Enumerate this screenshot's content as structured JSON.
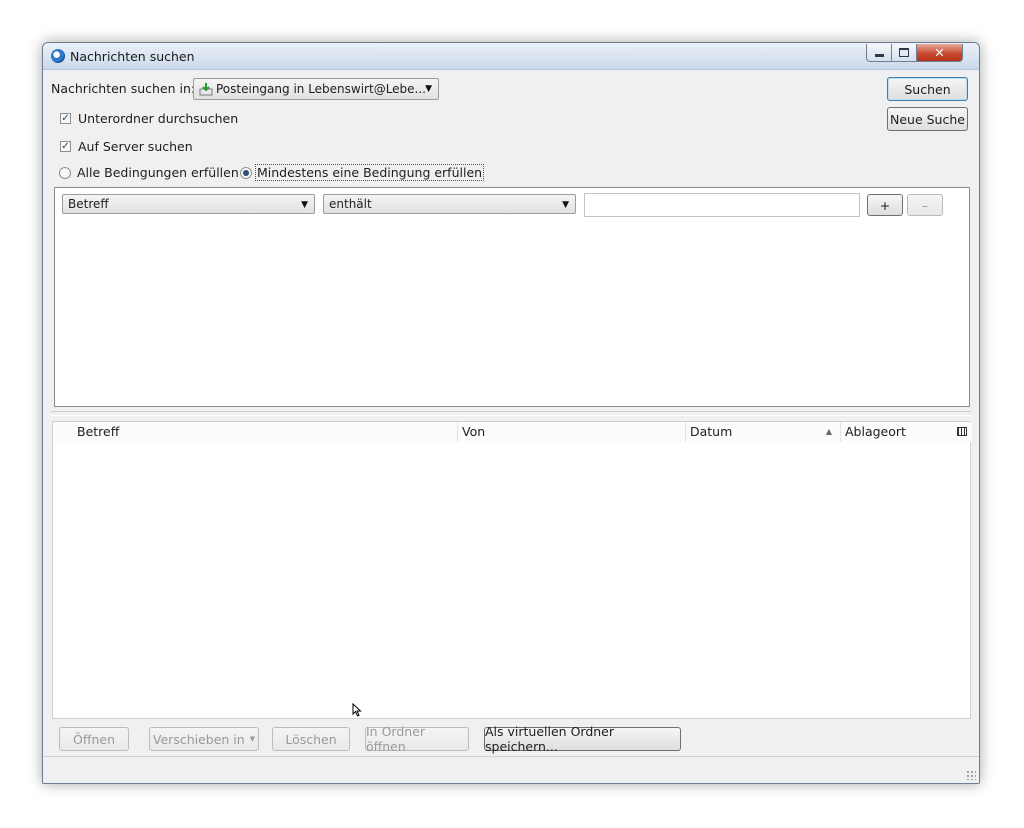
{
  "window": {
    "title": "Nachrichten suchen"
  },
  "search": {
    "label": "Nachrichten suchen in:",
    "folder": "Posteingang in Lebenswirt@Lebe...",
    "search_button": "Suchen",
    "new_search_button": "Neue Suche"
  },
  "options": {
    "subfolders_label": "Unterordner durchsuchen",
    "subfolders_checked": true,
    "server_label": "Auf Server suchen",
    "server_checked": true,
    "match_all_label": "Alle Bedingungen erfüllen",
    "match_any_label": "Mindestens eine Bedingung erfüllen",
    "selected_match": "any"
  },
  "criteria": {
    "field": "Betreff",
    "operator": "enthält",
    "value": "",
    "add_label": "+",
    "remove_label": "–"
  },
  "results": {
    "columns": [
      {
        "label": "Betreff"
      },
      {
        "label": "Von"
      },
      {
        "label": "Datum",
        "sort": "ascending"
      },
      {
        "label": "Ablageort"
      }
    ],
    "rows": []
  },
  "actions": {
    "open": "Öffnen",
    "move": "Verschieben in",
    "delete": "Löschen",
    "open_folder": "In Ordner öffnen",
    "save_virtual": "Als virtuellen Ordner speichern..."
  },
  "colors": {
    "window_bg": "#f0f0f0",
    "titlebar": "#d9e4f1",
    "close_button": "#c94a32",
    "default_button_border": "#3c7fb1"
  }
}
